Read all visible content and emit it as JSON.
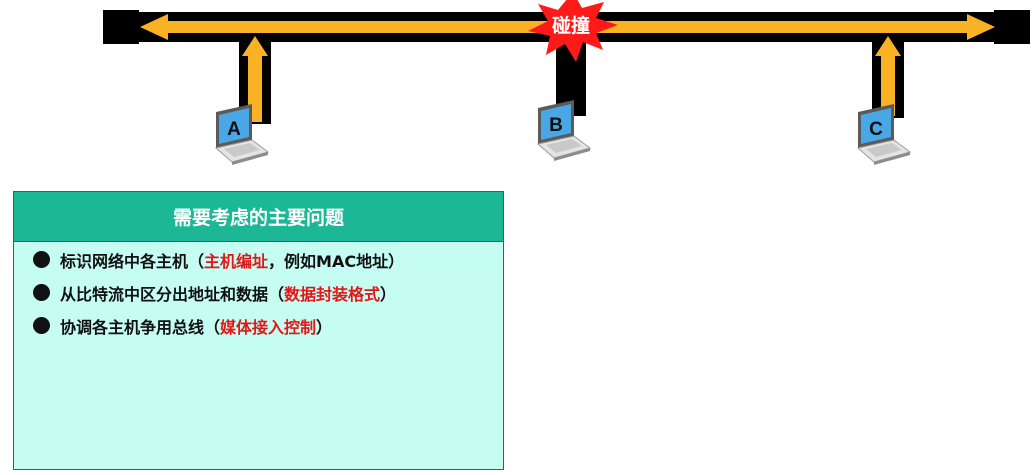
{
  "diagram": {
    "collision_label": "碰撞",
    "hosts": [
      {
        "label": "A"
      },
      {
        "label": "B"
      },
      {
        "label": "C"
      }
    ],
    "colors": {
      "bus": "#000000",
      "signal": "#f8b223",
      "collision": "#ff1a1a",
      "screen": "#4aa7e6"
    }
  },
  "issues": {
    "title": "需要考虑的主要问题",
    "items": [
      {
        "text": "标识网络中各主机（",
        "highlight": "主机编址",
        "suffix": "，例如MAC地址）"
      },
      {
        "text": "从比特流中区分出地址和数据（",
        "highlight": "数据封装格式",
        "suffix": "）"
      },
      {
        "text": "协调各主机争用总线（",
        "highlight": "媒体接入控制",
        "suffix": "）"
      }
    ]
  }
}
